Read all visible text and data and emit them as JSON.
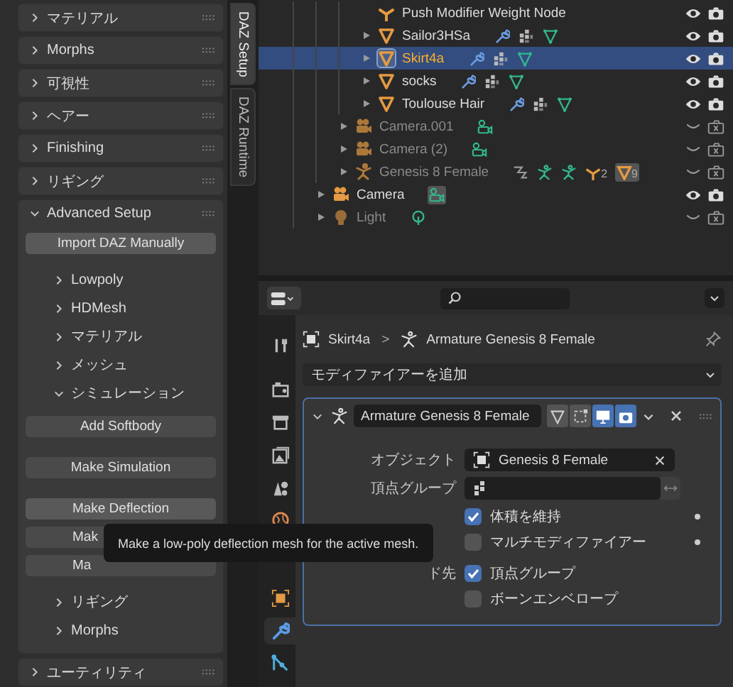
{
  "side_tabs": [
    {
      "label": "DAZ Setup",
      "selected": true
    },
    {
      "label": "DAZ Runtime",
      "selected": false
    }
  ],
  "panels": [
    {
      "label": "マテリアル",
      "expanded": false
    },
    {
      "label": "Morphs",
      "expanded": false
    },
    {
      "label": "可視性",
      "expanded": false
    },
    {
      "label": "ヘアー",
      "expanded": false
    },
    {
      "label": "Finishing",
      "expanded": false
    },
    {
      "label": "リギング",
      "expanded": false
    },
    {
      "label": "Advanced Setup",
      "expanded": true,
      "items": [
        {
          "kind": "button",
          "label": "Import DAZ Manually",
          "hovered": true
        },
        {
          "kind": "subpanel",
          "label": "Lowpoly",
          "expanded": false
        },
        {
          "kind": "subpanel",
          "label": "HDMesh",
          "expanded": false
        },
        {
          "kind": "subpanel",
          "label": "マテリアル",
          "expanded": false
        },
        {
          "kind": "subpanel",
          "label": "メッシュ",
          "expanded": false
        },
        {
          "kind": "subpanel",
          "label": "シミュレーション",
          "expanded": true,
          "button_groups": [
            {
              "buttons": [
                {
                  "label": "Add Softbody",
                  "hovered": false
                }
              ]
            },
            {
              "buttons": [
                {
                  "label": "Make Simulation",
                  "hovered": false
                }
              ]
            },
            {
              "buttons": [
                {
                  "label": "Make Deflection",
                  "hovered": true
                },
                {
                  "label": "Mak",
                  "hovered": false
                },
                {
                  "label": "Ma",
                  "hovered": false
                }
              ]
            }
          ]
        },
        {
          "kind": "subpanel",
          "label": "リギング",
          "expanded": false
        },
        {
          "kind": "subpanel",
          "label": "Morphs",
          "expanded": false
        }
      ]
    },
    {
      "label": "ユーティリティ",
      "expanded": false
    }
  ],
  "tooltip": {
    "text": "Make a low-poly deflection mesh for the active mesh."
  },
  "outliner": {
    "items": [
      {
        "children": [
          {
            "children": [
              {
                "name": "Push Modifier Weight Node",
                "kind": "empty",
                "expandable": false,
                "hidden": false,
                "selected": false
              },
              {
                "name": "Sailor3HSa",
                "kind": "mesh",
                "expandable": true,
                "hidden": false,
                "selected": false,
                "data": [
                  {
                    "kind": "modifier",
                    "highlighted": false
                  },
                  {
                    "kind": "vertex_groups",
                    "highlighted": false
                  },
                  {
                    "kind": "mesh_data",
                    "highlighted": false
                  }
                ]
              },
              {
                "name": "Skirt4a",
                "kind": "mesh",
                "expandable": true,
                "hidden": false,
                "selected": true,
                "data": [
                  {
                    "kind": "modifier",
                    "highlighted": false
                  },
                  {
                    "kind": "vertex_groups",
                    "highlighted": false
                  },
                  {
                    "kind": "mesh_data",
                    "highlighted": false
                  }
                ]
              },
              {
                "name": "socks",
                "kind": "mesh",
                "expandable": true,
                "hidden": false,
                "selected": false,
                "data": [
                  {
                    "kind": "modifier",
                    "highlighted": false
                  },
                  {
                    "kind": "vertex_groups",
                    "highlighted": false
                  },
                  {
                    "kind": "mesh_data",
                    "highlighted": false
                  }
                ]
              },
              {
                "name": "Toulouse Hair",
                "kind": "mesh",
                "expandable": true,
                "hidden": false,
                "selected": false,
                "data": [
                  {
                    "kind": "modifier",
                    "highlighted": false
                  },
                  {
                    "kind": "vertex_groups",
                    "highlighted": false
                  },
                  {
                    "kind": "mesh_data",
                    "highlighted": false
                  }
                ]
              }
            ]
          },
          {
            "name": "Camera.001",
            "kind": "camera",
            "expandable": true,
            "hidden": true,
            "selected": false,
            "data": [
              {
                "kind": "camera_data",
                "highlighted": false
              }
            ]
          },
          {
            "name": "Camera (2)",
            "kind": "camera",
            "expandable": true,
            "hidden": true,
            "selected": false,
            "data": [
              {
                "kind": "camera_data",
                "highlighted": false
              }
            ]
          },
          {
            "name": "Genesis 8 Female",
            "kind": "armature",
            "expandable": true,
            "hidden": true,
            "selected": false,
            "data": [
              {
                "kind": "constraint",
                "highlighted": false
              },
              {
                "kind": "pose",
                "highlighted": false
              },
              {
                "kind": "armature_data",
                "highlighted": false
              },
              {
                "kind": "empty",
                "count": "2",
                "highlighted": false
              },
              {
                "kind": "mesh",
                "count": "9",
                "highlighted": true
              }
            ]
          }
        ]
      },
      {
        "name": "Camera",
        "kind": "camera",
        "expandable": true,
        "hidden": false,
        "selected": false,
        "data": [
          {
            "kind": "camera_data",
            "highlighted": true
          }
        ]
      },
      {
        "name": "Light",
        "kind": "light",
        "expandable": true,
        "hidden": true,
        "selected": false,
        "data": [
          {
            "kind": "light_data",
            "highlighted": false
          }
        ]
      }
    ]
  },
  "properties": {
    "tab_groups": [
      {
        "tabs": [
          {
            "kind": "tool",
            "selected": false
          }
        ]
      },
      {
        "tabs": [
          {
            "kind": "render",
            "selected": false
          },
          {
            "kind": "output",
            "selected": false
          },
          {
            "kind": "view_layer",
            "selected": false
          },
          {
            "kind": "scene",
            "selected": false
          },
          {
            "kind": "world",
            "selected": false
          }
        ]
      },
      {
        "tabs": [
          {
            "kind": "object",
            "selected": false
          },
          {
            "kind": "modifier",
            "selected": true
          },
          {
            "kind": "particles",
            "selected": false
          }
        ]
      }
    ],
    "breadcrumb": {
      "object": "Skirt4a",
      "separator": ">",
      "modifier": "Armature Genesis 8 Female"
    },
    "add_modifier": "モディファイアーを追加",
    "modifier": {
      "name": "Armature Genesis 8 Female",
      "expanded": true,
      "toggles": [
        {
          "kind": "edit_mode",
          "on": false
        },
        {
          "kind": "cage",
          "on": false
        },
        {
          "kind": "viewport",
          "on": true
        },
        {
          "kind": "render",
          "on": true
        }
      ],
      "object_label": "オブジェクト",
      "object_value": "Genesis 8 Female",
      "vertex_group_label": "頂点グループ",
      "options": [
        {
          "label": "体積を維持",
          "checked": true,
          "animatable": true
        },
        {
          "label": "マルチモディファイアー",
          "checked": false,
          "animatable": true
        },
        {
          "row_label": "ド先",
          "label": "頂点グループ",
          "checked": true,
          "animatable": false
        },
        {
          "label": "ボーンエンベロープ",
          "checked": false,
          "animatable": false
        }
      ]
    }
  }
}
